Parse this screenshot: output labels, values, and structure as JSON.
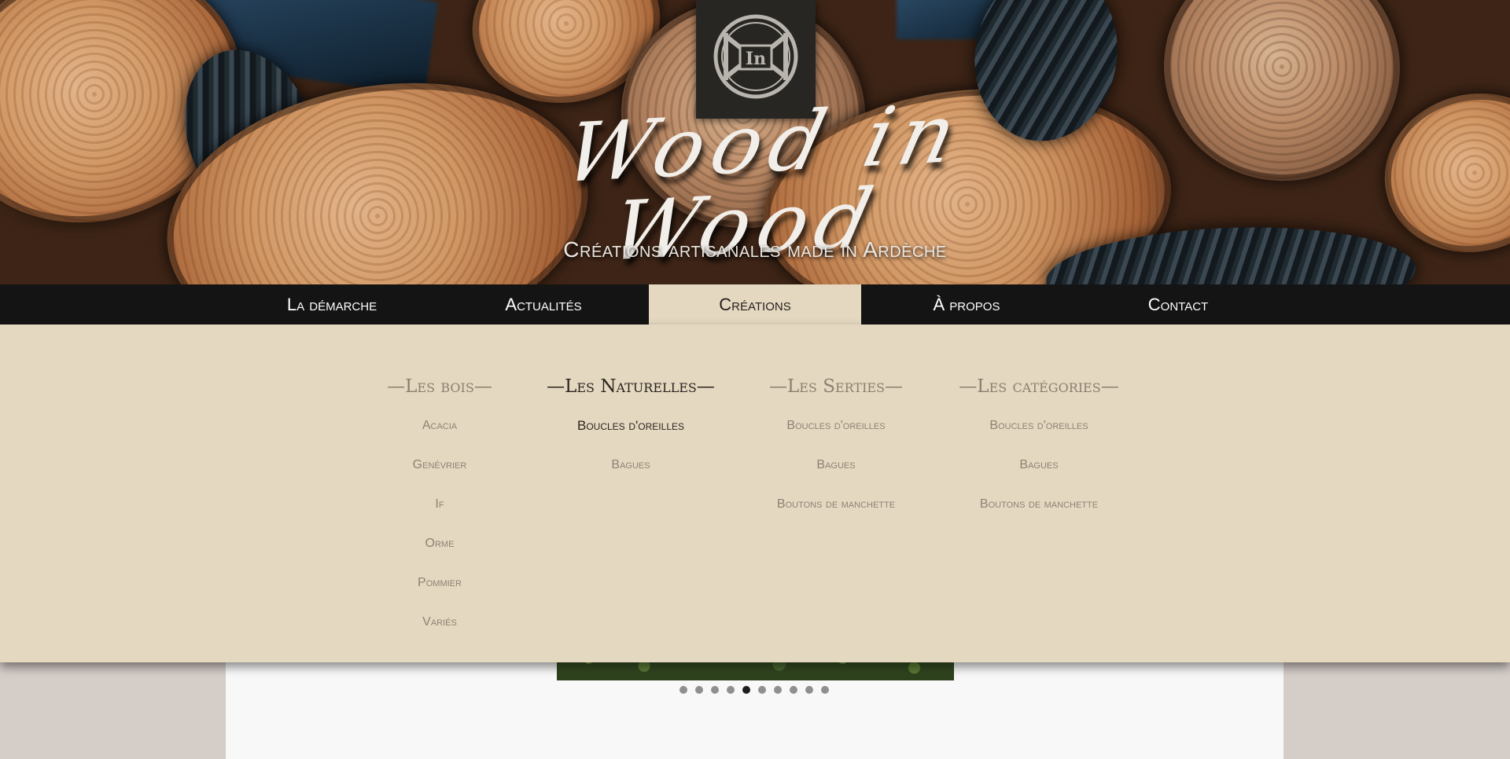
{
  "site": {
    "title": "Wood in Wood",
    "subtitle": "Créations artisanales made in Ardèche",
    "logo_text": "In",
    "logo_icon": "monogram-icon"
  },
  "nav": {
    "items": [
      {
        "label": "La démarche"
      },
      {
        "label": "Actualités"
      },
      {
        "label": "Créations",
        "active": true
      },
      {
        "label": "À propos"
      },
      {
        "label": "Contact"
      }
    ]
  },
  "mega_menu": {
    "columns": [
      {
        "heading": "—Les bois—",
        "links": [
          "Acacia",
          "Genévrier",
          "If",
          "Orme",
          "Pommier",
          "Variés"
        ]
      },
      {
        "heading": "—Les Naturelles—",
        "highlighted": true,
        "links": [
          "Boucles d'oreilles",
          "Bagues"
        ],
        "highlighted_link": "Boucles d'oreilles"
      },
      {
        "heading": "—Les Serties—",
        "links": [
          "Boucles d'oreilles",
          "Bagues",
          "Boutons de manchette"
        ]
      },
      {
        "heading": "—Les catégories—",
        "links": [
          "Boucles d'oreilles",
          "Bagues",
          "Boutons de manchette"
        ]
      }
    ]
  },
  "slider": {
    "slide_count": 10,
    "active_index": 4
  },
  "colors": {
    "nav_bg": "#141414",
    "menu_bg": "#e4d8c0",
    "page_bg": "#d5cdc8",
    "sheet_bg": "#f8f8f8",
    "muted_text": "#8d8375",
    "dark_text": "#2b2520"
  }
}
